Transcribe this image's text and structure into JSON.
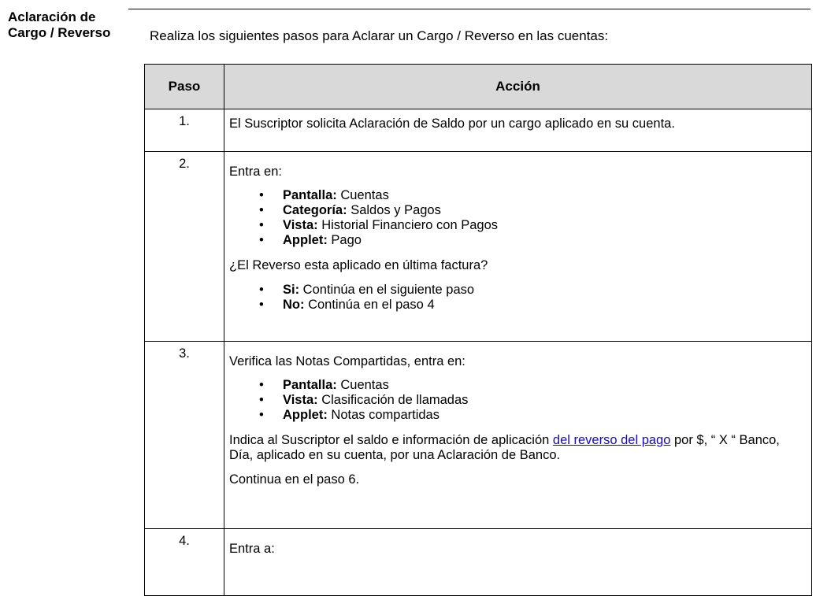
{
  "section": {
    "title_line1": "Aclaración de",
    "title_line2": "Cargo / Reverso",
    "intro": "Realiza los siguientes pasos para Aclarar un Cargo / Reverso en las cuentas:"
  },
  "table": {
    "headers": {
      "step": "Paso",
      "action": "Acción"
    },
    "rows": [
      {
        "step": "1.",
        "text": "El Suscriptor solicita Aclaración de Saldo por un cargo aplicado en su cuenta."
      },
      {
        "step": "2.",
        "intro": "Entra en:",
        "bullets": [
          {
            "label": "Pantalla:",
            "value": " Cuentas"
          },
          {
            "label": "Categoría:",
            "value": " Saldos y Pagos"
          },
          {
            "label": "Vista:",
            "value": " Historial Financiero con Pagos"
          },
          {
            "label": "Applet:",
            "value": " Pago"
          }
        ],
        "question": "¿El Reverso esta aplicado en última factura?",
        "options": [
          {
            "label": "Si:",
            "value": " Continúa en el siguiente paso"
          },
          {
            "label": "No:",
            "value": " Continúa en el paso 4"
          }
        ]
      },
      {
        "step": "3.",
        "intro": "Verifica las Notas Compartidas, entra en:",
        "bullets": [
          {
            "label": "Pantalla:",
            "value": " Cuentas"
          },
          {
            "label": "Vista:",
            "value": " Clasificación de llamadas"
          },
          {
            "label": "Applet:",
            "value": " Notas compartidas"
          }
        ],
        "para_before_link": "Indica al Suscriptor el saldo e información de aplicación ",
        "link_text": "del reverso del pago",
        "para_after_link": " por $, “ X “ Banco, Día, aplicado en su cuenta, por una Aclaración de Banco.",
        "continue_text": "Continua en el paso 6."
      },
      {
        "step": "4.",
        "intro": "Entra a:"
      }
    ]
  }
}
